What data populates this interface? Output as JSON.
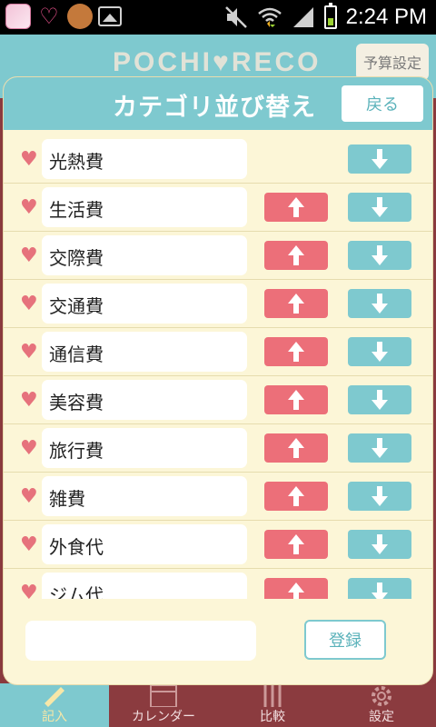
{
  "status_bar": {
    "time": "2:24 PM"
  },
  "background": {
    "logo": "POCHI♥RECO",
    "budget_button": "予算設定",
    "tabs": [
      {
        "label": "記入"
      },
      {
        "label": "カレンダー"
      },
      {
        "label": "比較"
      },
      {
        "label": "設定"
      }
    ]
  },
  "dialog": {
    "title": "カテゴリ並び替え",
    "back_label": "戻る",
    "categories": [
      {
        "name": "光熱費"
      },
      {
        "name": "生活費"
      },
      {
        "name": "交際費"
      },
      {
        "name": "交通費"
      },
      {
        "name": "通信費"
      },
      {
        "name": "美容費"
      },
      {
        "name": "旅行費"
      },
      {
        "name": "雑費"
      },
      {
        "name": "外食代"
      },
      {
        "name": "ジム代"
      }
    ],
    "new_category_value": "",
    "register_label": "登録"
  },
  "colors": {
    "teal": "#7ec9cf",
    "pink": "#ec6f79",
    "cream": "#fcf6d7",
    "heart": "#e6727c"
  }
}
